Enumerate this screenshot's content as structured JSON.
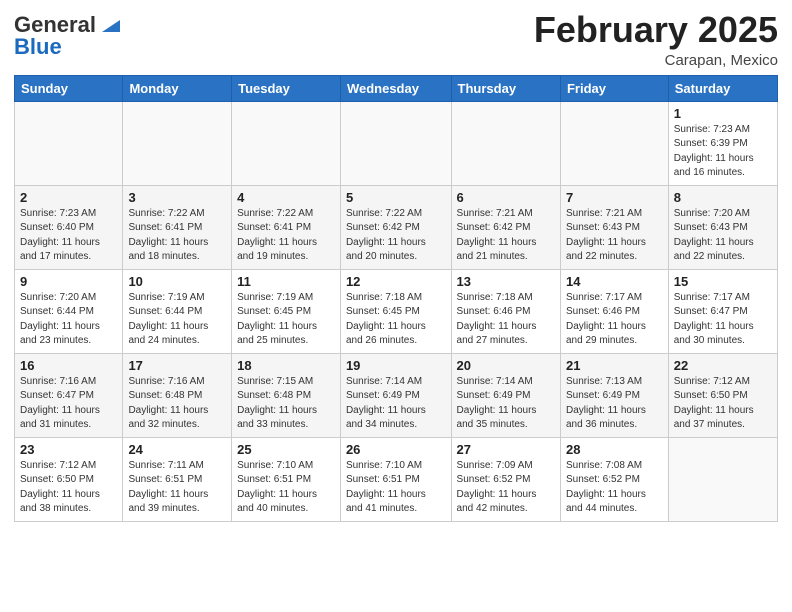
{
  "header": {
    "logo": {
      "general": "General",
      "blue": "Blue"
    },
    "month": "February 2025",
    "location": "Carapan, Mexico"
  },
  "weekdays": [
    "Sunday",
    "Monday",
    "Tuesday",
    "Wednesday",
    "Thursday",
    "Friday",
    "Saturday"
  ],
  "weeks": [
    [
      {
        "day": "",
        "info": ""
      },
      {
        "day": "",
        "info": ""
      },
      {
        "day": "",
        "info": ""
      },
      {
        "day": "",
        "info": ""
      },
      {
        "day": "",
        "info": ""
      },
      {
        "day": "",
        "info": ""
      },
      {
        "day": "1",
        "info": "Sunrise: 7:23 AM\nSunset: 6:39 PM\nDaylight: 11 hours\nand 16 minutes."
      }
    ],
    [
      {
        "day": "2",
        "info": "Sunrise: 7:23 AM\nSunset: 6:40 PM\nDaylight: 11 hours\nand 17 minutes."
      },
      {
        "day": "3",
        "info": "Sunrise: 7:22 AM\nSunset: 6:41 PM\nDaylight: 11 hours\nand 18 minutes."
      },
      {
        "day": "4",
        "info": "Sunrise: 7:22 AM\nSunset: 6:41 PM\nDaylight: 11 hours\nand 19 minutes."
      },
      {
        "day": "5",
        "info": "Sunrise: 7:22 AM\nSunset: 6:42 PM\nDaylight: 11 hours\nand 20 minutes."
      },
      {
        "day": "6",
        "info": "Sunrise: 7:21 AM\nSunset: 6:42 PM\nDaylight: 11 hours\nand 21 minutes."
      },
      {
        "day": "7",
        "info": "Sunrise: 7:21 AM\nSunset: 6:43 PM\nDaylight: 11 hours\nand 22 minutes."
      },
      {
        "day": "8",
        "info": "Sunrise: 7:20 AM\nSunset: 6:43 PM\nDaylight: 11 hours\nand 22 minutes."
      }
    ],
    [
      {
        "day": "9",
        "info": "Sunrise: 7:20 AM\nSunset: 6:44 PM\nDaylight: 11 hours\nand 23 minutes."
      },
      {
        "day": "10",
        "info": "Sunrise: 7:19 AM\nSunset: 6:44 PM\nDaylight: 11 hours\nand 24 minutes."
      },
      {
        "day": "11",
        "info": "Sunrise: 7:19 AM\nSunset: 6:45 PM\nDaylight: 11 hours\nand 25 minutes."
      },
      {
        "day": "12",
        "info": "Sunrise: 7:18 AM\nSunset: 6:45 PM\nDaylight: 11 hours\nand 26 minutes."
      },
      {
        "day": "13",
        "info": "Sunrise: 7:18 AM\nSunset: 6:46 PM\nDaylight: 11 hours\nand 27 minutes."
      },
      {
        "day": "14",
        "info": "Sunrise: 7:17 AM\nSunset: 6:46 PM\nDaylight: 11 hours\nand 29 minutes."
      },
      {
        "day": "15",
        "info": "Sunrise: 7:17 AM\nSunset: 6:47 PM\nDaylight: 11 hours\nand 30 minutes."
      }
    ],
    [
      {
        "day": "16",
        "info": "Sunrise: 7:16 AM\nSunset: 6:47 PM\nDaylight: 11 hours\nand 31 minutes."
      },
      {
        "day": "17",
        "info": "Sunrise: 7:16 AM\nSunset: 6:48 PM\nDaylight: 11 hours\nand 32 minutes."
      },
      {
        "day": "18",
        "info": "Sunrise: 7:15 AM\nSunset: 6:48 PM\nDaylight: 11 hours\nand 33 minutes."
      },
      {
        "day": "19",
        "info": "Sunrise: 7:14 AM\nSunset: 6:49 PM\nDaylight: 11 hours\nand 34 minutes."
      },
      {
        "day": "20",
        "info": "Sunrise: 7:14 AM\nSunset: 6:49 PM\nDaylight: 11 hours\nand 35 minutes."
      },
      {
        "day": "21",
        "info": "Sunrise: 7:13 AM\nSunset: 6:49 PM\nDaylight: 11 hours\nand 36 minutes."
      },
      {
        "day": "22",
        "info": "Sunrise: 7:12 AM\nSunset: 6:50 PM\nDaylight: 11 hours\nand 37 minutes."
      }
    ],
    [
      {
        "day": "23",
        "info": "Sunrise: 7:12 AM\nSunset: 6:50 PM\nDaylight: 11 hours\nand 38 minutes."
      },
      {
        "day": "24",
        "info": "Sunrise: 7:11 AM\nSunset: 6:51 PM\nDaylight: 11 hours\nand 39 minutes."
      },
      {
        "day": "25",
        "info": "Sunrise: 7:10 AM\nSunset: 6:51 PM\nDaylight: 11 hours\nand 40 minutes."
      },
      {
        "day": "26",
        "info": "Sunrise: 7:10 AM\nSunset: 6:51 PM\nDaylight: 11 hours\nand 41 minutes."
      },
      {
        "day": "27",
        "info": "Sunrise: 7:09 AM\nSunset: 6:52 PM\nDaylight: 11 hours\nand 42 minutes."
      },
      {
        "day": "28",
        "info": "Sunrise: 7:08 AM\nSunset: 6:52 PM\nDaylight: 11 hours\nand 44 minutes."
      },
      {
        "day": "",
        "info": ""
      }
    ]
  ]
}
